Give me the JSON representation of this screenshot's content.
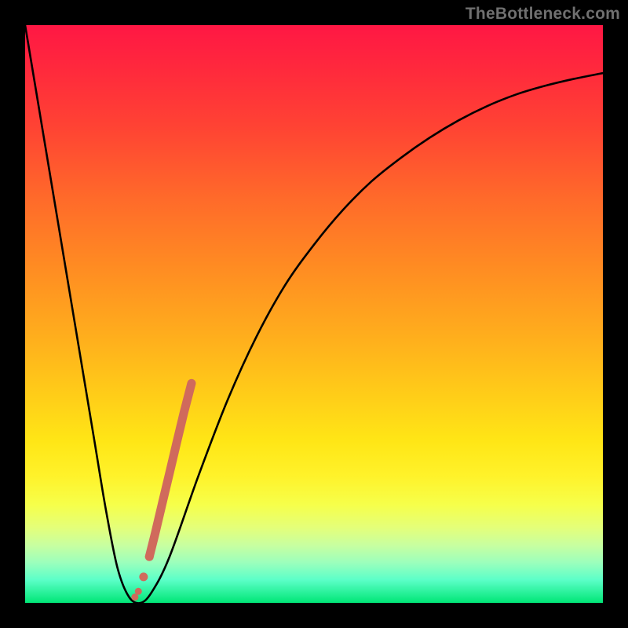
{
  "watermark": "TheBottleneck.com",
  "colors": {
    "frame": "#000000",
    "curve": "#000000",
    "scatter": "#d06a5c"
  },
  "chart_data": {
    "type": "line",
    "title": "",
    "xlabel": "",
    "ylabel": "",
    "xlim": [
      0,
      100
    ],
    "ylim": [
      0,
      100
    ],
    "grid": false,
    "legend": false,
    "series": [
      {
        "name": "bottleneck-curve",
        "x": [
          0,
          2,
          4,
          6,
          8,
          10,
          12,
          14,
          16,
          18,
          20,
          22,
          25,
          30,
          35,
          40,
          45,
          50,
          55,
          60,
          65,
          70,
          75,
          80,
          85,
          90,
          95,
          100
        ],
        "y": [
          100,
          88,
          76,
          64,
          52,
          40,
          28,
          16,
          6,
          1,
          0,
          2,
          8,
          22,
          35,
          46,
          55,
          62,
          68,
          73,
          77,
          80.5,
          83.5,
          86,
          88,
          89.5,
          90.7,
          91.7
        ]
      }
    ],
    "scatter": {
      "name": "highlight-points",
      "x": [
        19.0,
        19.6,
        20.5,
        21.5,
        22.5,
        23.8,
        25.0,
        26.3,
        27.5,
        28.8
      ],
      "y": [
        1.0,
        2.0,
        4.5,
        8.0,
        12.0,
        17.5,
        22.5,
        28.0,
        33.0,
        38.0
      ]
    }
  }
}
